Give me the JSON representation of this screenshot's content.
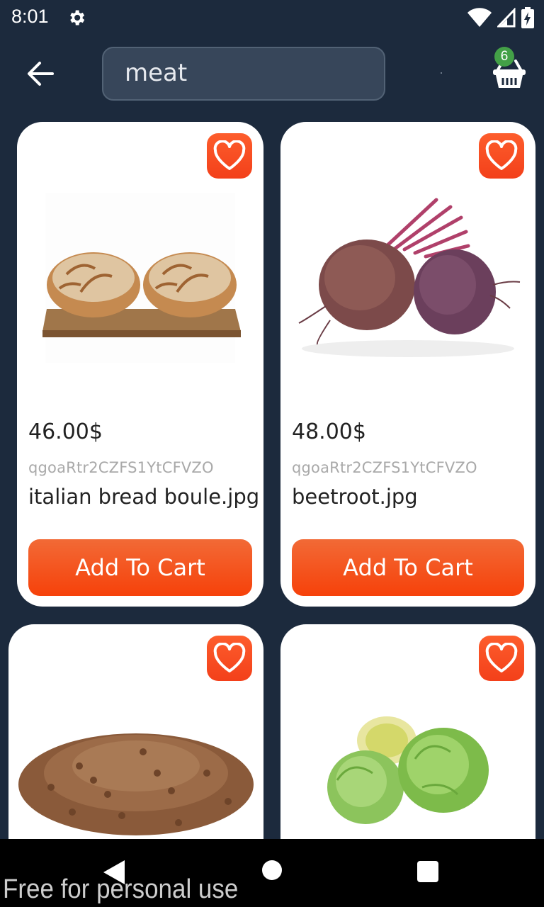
{
  "status_bar": {
    "time": "8:01",
    "icons": [
      "gear-icon",
      "wifi-icon",
      "signal-icon",
      "battery-icon"
    ]
  },
  "header": {
    "back_icon": "arrow-left-icon",
    "search": {
      "value": "meat",
      "placeholder": ""
    },
    "cart": {
      "icon": "basket-icon",
      "count": "6"
    }
  },
  "colors": {
    "background": "#1c2a3d",
    "accent": "#f6410a",
    "badge": "#43a047",
    "card": "#ffffff"
  },
  "products": [
    {
      "price": "46.00$",
      "id": "qgoaRtr2CZFS1YtCFVZO",
      "name": "italian bread boule.jpg",
      "button": "Add To Cart",
      "image": "bread-image"
    },
    {
      "price": "48.00$",
      "id": "qgoaRtr2CZFS1YtCFVZO",
      "name": "beetroot.jpg",
      "button": "Add To Cart",
      "image": "beetroot-image"
    },
    {
      "image": "beans-image"
    },
    {
      "image": "cabbage-image"
    }
  ],
  "nav": {
    "icons": [
      "nav-back-icon",
      "nav-home-icon",
      "nav-recent-icon"
    ]
  },
  "watermark": "Free for personal use"
}
